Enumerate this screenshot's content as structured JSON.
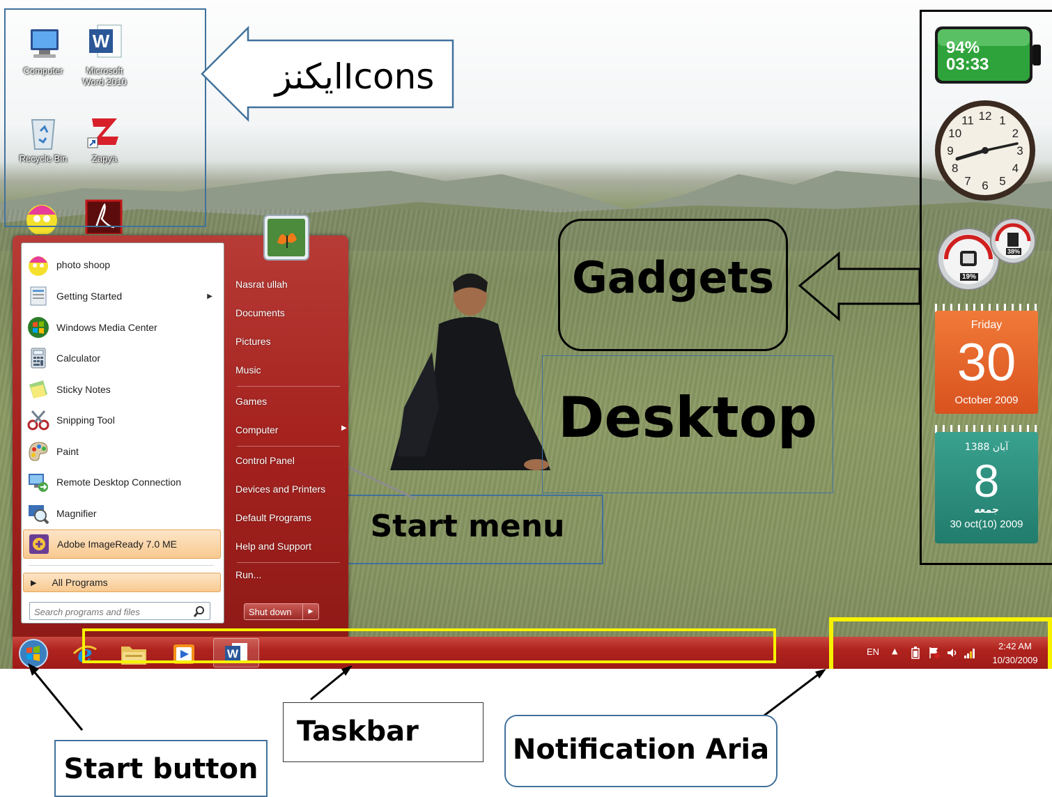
{
  "desktop": {
    "icons": [
      {
        "label_1": "Computer",
        "label_2": "",
        "icon": "computer-icon"
      },
      {
        "label_1": "Microsoft",
        "label_2": "Word 2010",
        "icon": "word-icon"
      },
      {
        "label_1": "Recycle Bin",
        "label_2": "",
        "icon": "recycle-bin-icon"
      },
      {
        "label_1": "Zapya",
        "label_2": "",
        "icon": "zapya-icon"
      }
    ]
  },
  "annotations": {
    "icons": "ایکنزIcons",
    "gadgets": "Gadgets",
    "desktop": "Desktop",
    "start_menu": "Start menu",
    "taskbar": "Taskbar",
    "notification": "Notification Aria",
    "start_button": "Start button"
  },
  "gadgets": {
    "battery": {
      "percent": "94%",
      "time": "03:33",
      "color": "#2fa33b"
    },
    "clock": {
      "numbers": [
        "12",
        "1",
        "2",
        "3",
        "4",
        "5",
        "6",
        "7",
        "8",
        "9",
        "10",
        "11"
      ]
    },
    "cpu_meter": {
      "cpu": "19%",
      "ram": "38%"
    },
    "calendar": {
      "day_name": "Friday",
      "day": "30",
      "month_year": "October 2009",
      "color": "#e8602a"
    },
    "persian_calendar": {
      "year": "1388 آبان",
      "day": "8",
      "weekday": "جمعه",
      "date": "30 oct(10) 2009",
      "color": "#2f8f7f"
    }
  },
  "start_menu": {
    "left_items": [
      {
        "label": "photo shoop",
        "icon": "smiley-icon",
        "submenu": false
      },
      {
        "label": "Getting Started",
        "icon": "getting-started-icon",
        "submenu": true
      },
      {
        "label": "Windows Media Center",
        "icon": "media-center-icon",
        "submenu": false
      },
      {
        "label": "Calculator",
        "icon": "calculator-icon",
        "submenu": false
      },
      {
        "label": "Sticky Notes",
        "icon": "sticky-notes-icon",
        "submenu": false
      },
      {
        "label": "Snipping Tool",
        "icon": "snipping-tool-icon",
        "submenu": false
      },
      {
        "label": "Paint",
        "icon": "paint-icon",
        "submenu": false
      },
      {
        "label": "Remote Desktop Connection",
        "icon": "remote-desktop-icon",
        "submenu": false
      },
      {
        "label": "Magnifier",
        "icon": "magnifier-icon",
        "submenu": false
      },
      {
        "label": "Adobe ImageReady 7.0 ME",
        "icon": "imageready-icon",
        "submenu": false
      }
    ],
    "all_programs": "All Programs",
    "search_placeholder": "Search programs and files",
    "right_items": [
      "Nasrat ullah",
      "Documents",
      "Pictures",
      "Music",
      "Games",
      "Computer",
      "Control Panel",
      "Devices and Printers",
      "Default Programs",
      "Help and Support",
      "Run..."
    ],
    "shutdown": "Shut down"
  },
  "taskbar": {
    "pinned": [
      "internet-explorer-icon",
      "explorer-folder-icon",
      "media-player-icon",
      "word-icon"
    ],
    "tray": {
      "language": "EN",
      "time": "2:42 AM",
      "date": "10/30/2009"
    }
  }
}
